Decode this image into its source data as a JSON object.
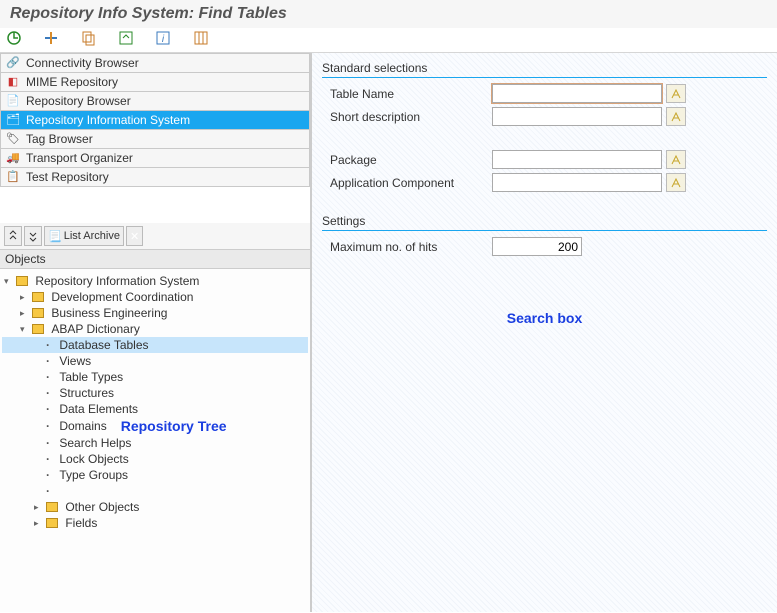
{
  "title": "Repository Info System: Find Tables",
  "nav": {
    "items": [
      {
        "label": "Connectivity Browser"
      },
      {
        "label": "MIME Repository"
      },
      {
        "label": "Repository Browser"
      },
      {
        "label": "Repository Information System"
      },
      {
        "label": "Tag Browser"
      },
      {
        "label": "Transport Organizer"
      },
      {
        "label": "Test Repository"
      }
    ]
  },
  "midtools": {
    "list_archive": "List Archive"
  },
  "objects_header": "Objects",
  "tree": {
    "root": "Repository Information System",
    "level1": [
      {
        "label": "Development Coordination"
      },
      {
        "label": "Business Engineering"
      },
      {
        "label": "ABAP Dictionary"
      }
    ],
    "abap_children": [
      "Database Tables",
      "Views",
      "Table Types",
      "Structures",
      "Data Elements",
      "Domains",
      "Search Helps",
      "Lock Objects",
      "Type Groups",
      ""
    ],
    "tail": [
      {
        "label": "Other Objects"
      },
      {
        "label": "Fields"
      }
    ]
  },
  "annotations": {
    "tree": "Repository Tree",
    "search": "Search box"
  },
  "form": {
    "standard_title": "Standard selections",
    "fields": {
      "table_name": "Table Name",
      "short_desc": "Short description",
      "package": "Package",
      "app_comp": "Application Component"
    },
    "settings_title": "Settings",
    "max_hits_label": "Maximum no. of hits",
    "max_hits_value": "200"
  }
}
